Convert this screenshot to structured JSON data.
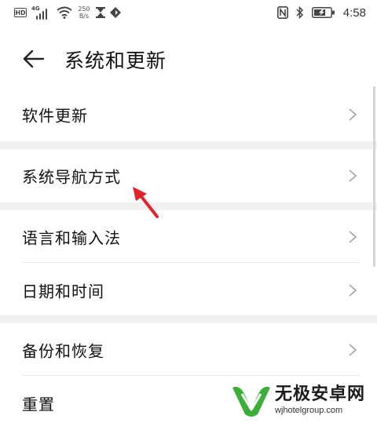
{
  "status_bar": {
    "hd": "HD",
    "network": "4G",
    "speed_value": "250",
    "speed_unit": "B/s",
    "time": "4:58"
  },
  "header": {
    "title": "系统和更新"
  },
  "groups": [
    {
      "items": [
        {
          "label": "软件更新"
        }
      ]
    },
    {
      "items": [
        {
          "label": "系统导航方式"
        }
      ]
    },
    {
      "items": [
        {
          "label": "语言和输入法"
        },
        {
          "label": "日期和时间"
        }
      ]
    },
    {
      "items": [
        {
          "label": "备份和恢复"
        },
        {
          "label": "重置"
        }
      ]
    }
  ],
  "watermark": {
    "name": "无极安卓网",
    "url": "wjhotelgroup.com"
  },
  "colors": {
    "background": "#ffffff",
    "separator": "#f1f1f1",
    "chevron": "#a8a8a8",
    "annotation_arrow": "#e0242b",
    "watermark_green": "#3dae3a"
  },
  "icons": {
    "back": "arrow-left-icon",
    "chevron": "chevron-right-icon",
    "wifi": "wifi-icon",
    "nfc": "nfc-icon",
    "bluetooth": "bluetooth-icon",
    "battery": "battery-charging-icon"
  }
}
